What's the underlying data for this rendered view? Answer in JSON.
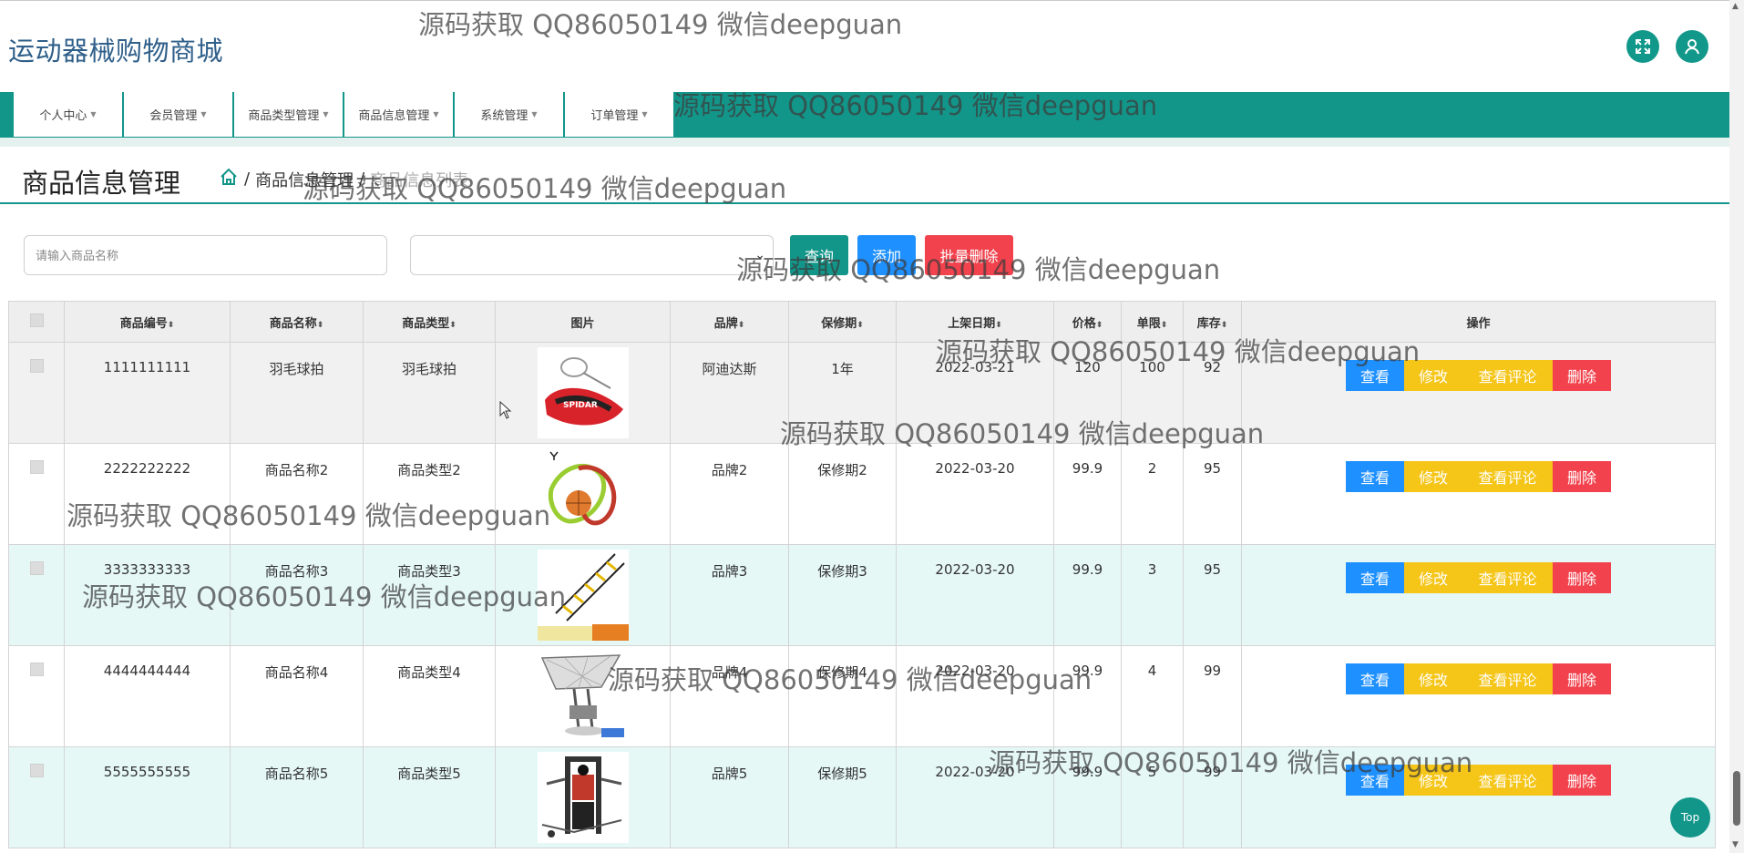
{
  "header": {
    "brand": "运动器械购物商城",
    "fullscreen_icon": "expand-icon",
    "user_icon": "user-icon"
  },
  "nav": {
    "items": [
      {
        "label": "个人中心"
      },
      {
        "label": "会员管理"
      },
      {
        "label": "商品类型管理"
      },
      {
        "label": "商品信息管理"
      },
      {
        "label": "系统管理"
      },
      {
        "label": "订单管理"
      }
    ]
  },
  "page": {
    "title": "商品信息管理",
    "breadcrumb": [
      "商品信息管理",
      "/",
      "商品信息列表"
    ]
  },
  "search": {
    "placeholder": "请输入商品名称",
    "select_value": "",
    "query_label": "查询",
    "add_label": "添加",
    "batch_delete_label": "批量删除"
  },
  "table": {
    "columns": [
      "商品编号",
      "商品名称",
      "商品类型",
      "图片",
      "品牌",
      "保修期",
      "上架日期",
      "价格",
      "单限",
      "库存",
      "操作"
    ],
    "sortable": [
      true,
      true,
      true,
      false,
      true,
      true,
      true,
      true,
      true,
      true,
      false
    ],
    "rows": [
      {
        "code": "1111111111",
        "name": "羽毛球拍",
        "type": "羽毛球拍",
        "image_icon": "badminton-racket-image",
        "brand": "阿迪达斯",
        "warranty": "1年",
        "date": "2022-03-21",
        "price": "120",
        "limit": "100",
        "stock": "92"
      },
      {
        "code": "2222222222",
        "name": "商品名称2",
        "type": "商品类型2",
        "image_icon": "agility-ring-image",
        "brand": "品牌2",
        "warranty": "保修期2",
        "date": "2022-03-20",
        "price": "99.9",
        "limit": "2",
        "stock": "95"
      },
      {
        "code": "3333333333",
        "name": "商品名称3",
        "type": "商品类型3",
        "image_icon": "agility-ladder-image",
        "brand": "品牌3",
        "warranty": "保修期3",
        "date": "2022-03-20",
        "price": "99.9",
        "limit": "3",
        "stock": "95"
      },
      {
        "code": "4444444444",
        "name": "商品名称4",
        "type": "商品类型4",
        "image_icon": "basketball-machine-image",
        "brand": "品牌4",
        "warranty": "保修期4",
        "date": "2022-03-20",
        "price": "99.9",
        "limit": "4",
        "stock": "99"
      },
      {
        "code": "5555555555",
        "name": "商品名称5",
        "type": "商品类型5",
        "image_icon": "home-gym-image",
        "brand": "品牌5",
        "warranty": "保修期5",
        "date": "2022-03-20",
        "price": "99.9",
        "limit": "5",
        "stock": "99"
      }
    ],
    "actions": {
      "view": "查看",
      "edit": "修改",
      "review": "查看评论",
      "delete": "删除"
    }
  },
  "watermark": "源码获取 QQ86050149 微信deepguan",
  "top_button": "Top",
  "colors": {
    "primary": "#13968a",
    "blue": "#1e90ff",
    "yellow": "#f5c518",
    "red": "#f1424d"
  }
}
